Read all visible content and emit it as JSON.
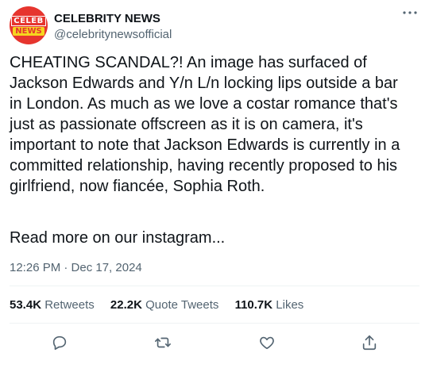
{
  "account": {
    "avatar_top": "CELEB",
    "avatar_bottom": "NEWS",
    "display_name": "CELEBRITY NEWS",
    "handle": "@celebritynewsofficial"
  },
  "tweet": {
    "text": "CHEATING SCANDAL?! An image has surfaced of\nJackson Edwards and Y/n L/n locking lips outside a bar\nin London. As much as we love a costar romance that's\njust as passionate offscreen as it is on camera, it's\nimportant to note that Jackson Edwards is currently in a\ncommitted relationship, having recently proposed to his\ngirlfriend, now fiancée, Sophia Roth.",
    "read_more": "Read more on our instagram...",
    "timestamp": "12:26 PM · Dec 17, 2024"
  },
  "stats": {
    "retweets_count": "53.4K",
    "retweets_label": "Retweets",
    "quotes_count": "22.2K",
    "quotes_label": "Quote Tweets",
    "likes_count": "110.7K",
    "likes_label": "Likes"
  },
  "icons": [
    "more-icon",
    "reply-icon",
    "retweet-icon",
    "like-icon",
    "share-icon"
  ],
  "colors": {
    "text": "#0f1419",
    "secondary": "#536471",
    "divider": "#eff3f4",
    "avatar_red": "#e6352e",
    "avatar_yellow": "#f5d51f"
  }
}
